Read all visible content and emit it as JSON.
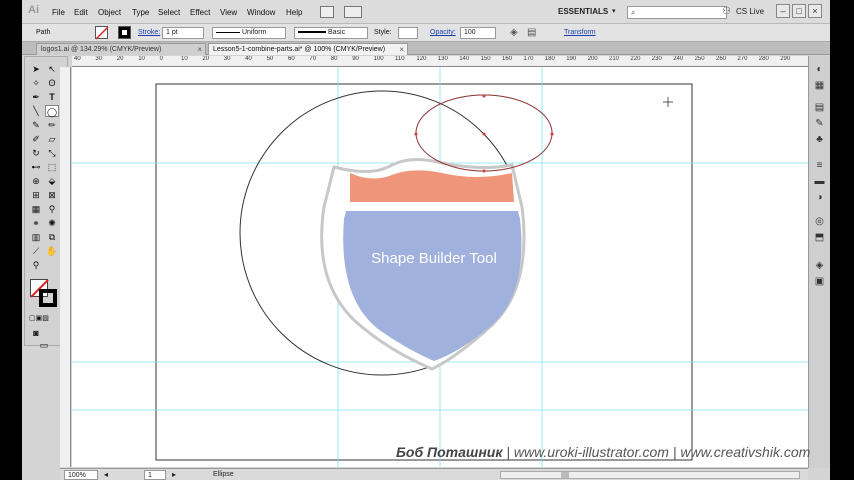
{
  "app": {
    "logo": "Ai"
  },
  "menu": [
    "File",
    "Edit",
    "Object",
    "Type",
    "Select",
    "Effect",
    "View",
    "Window",
    "Help"
  ],
  "workspace": {
    "label": "ESSENTIALS",
    "search_placeholder": "",
    "cs_live": "CS Live"
  },
  "control_bar": {
    "selection_type": "Path",
    "stroke_label": "Stroke:",
    "stroke_weight": "1 pt",
    "profile": "Uniform",
    "brush": "Basic",
    "style_label": "Style:",
    "opacity_label": "Opacity:",
    "opacity_value": "100",
    "transform_label": "Transform"
  },
  "tabs": [
    {
      "label": "logos1.ai @ 134.29% (CMYK/Preview)",
      "close": "×"
    },
    {
      "label": "Lesson5-1-combine-parts.ai* @ 100% (CMYK/Preview)",
      "close": "×"
    }
  ],
  "ruler": {
    "h_ticks": [
      "40",
      "30",
      "20",
      "10",
      "0",
      "10",
      "20",
      "30",
      "40",
      "50",
      "60",
      "70",
      "80",
      "90",
      "100",
      "110",
      "120",
      "130",
      "140",
      "150",
      "160",
      "170",
      "180",
      "190",
      "200",
      "210",
      "220",
      "230",
      "240",
      "250",
      "260",
      "270",
      "280",
      "290"
    ]
  },
  "canvas": {
    "artwork_text": "Shape Builder Tool",
    "colors": {
      "orange_band": "#ef967a",
      "blue_shield": "#9fb1dc",
      "shield_outline": "#c8c8c8",
      "guide": "#7fe3ea",
      "selection": "#d23b3b"
    }
  },
  "status_bar": {
    "zoom": "100%",
    "page": "1",
    "tool": "Ellipse"
  },
  "watermark": {
    "author": "Боб Поташник",
    "sep1": " | ",
    "site1": "www.uroki-illustrator.com",
    "sep2": " | ",
    "site2": "www.creativshik.com"
  }
}
